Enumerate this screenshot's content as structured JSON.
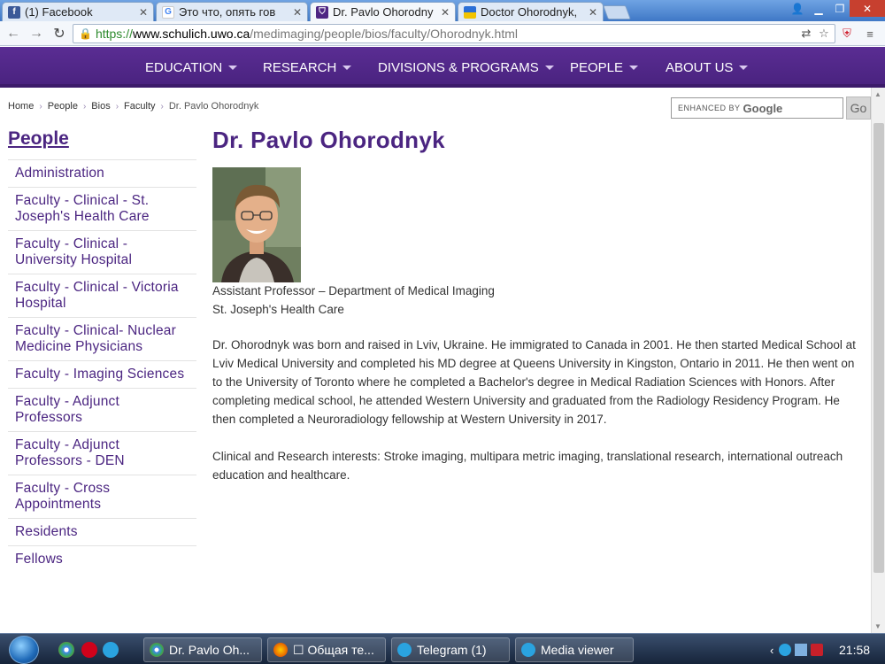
{
  "browser": {
    "tabs": [
      {
        "label": "(1) Facebook",
        "favicon": "facebook-icon",
        "active": false
      },
      {
        "label": "Это что, опять гов",
        "favicon": "google-icon",
        "active": false
      },
      {
        "label": "Dr. Pavlo Ohorodny",
        "favicon": "western-crest-icon",
        "active": true
      },
      {
        "label": "Doctor Ohorodnyk,",
        "favicon": "flag-icon",
        "active": false
      }
    ],
    "url": {
      "scheme": "https://",
      "host": "www.schulich.uwo.ca",
      "path": "/medimaging/people/bios/faculty/Ohorodnyk.html"
    }
  },
  "site_nav": {
    "items": [
      "EDUCATION",
      "RESEARCH",
      "DIVISIONS & PROGRAMS",
      "PEOPLE",
      "ABOUT US"
    ]
  },
  "breadcrumb": {
    "items": [
      "Home",
      "People",
      "Bios",
      "Faculty"
    ],
    "current": "Dr. Pavlo Ohorodnyk"
  },
  "search": {
    "enhanced_by": "ENHANCED BY",
    "brand": "Google",
    "go_label": "Go"
  },
  "sidebar": {
    "title": "People",
    "items": [
      "Administration",
      "Faculty - Clinical - St. Joseph's Health Care",
      "Faculty - Clinical - University Hospital",
      "Faculty - Clinical - Victoria Hospital",
      "Faculty - Clinical- Nuclear Medicine Physicians",
      "Faculty - Imaging Sciences",
      "Faculty - Adjunct Professors",
      "Faculty - Adjunct Professors - DEN",
      "Faculty - Cross Appointments",
      "Residents",
      "Fellows"
    ]
  },
  "profile": {
    "name": "Dr. Pavlo Ohorodnyk",
    "title": "Assistant Professor – Department of Medical Imaging",
    "organization": "St. Joseph's Health Care",
    "bio": "Dr. Ohorodnyk was born and raised in Lviv, Ukraine. He immigrated to Canada in 2001. He then started Medical School at Lviv Medical University and completed his MD degree at Queens University in Kingston, Ontario in 2011. He then went on to the University of Toronto where he completed a Bachelor's degree in Medical Radiation Sciences with Honors. After completing medical school, he attended Western University and graduated from the Radiology Residency Program. He then completed a Neuroradiology fellowship at Western University in 2017.",
    "interests": "Clinical and Research interests: Stroke imaging, multipara metric imaging, translational research, international outreach education and healthcare."
  },
  "taskbar": {
    "buttons": [
      {
        "label": "Dr. Pavlo Oh..."
      },
      {
        "label": "☐ Общая те..."
      },
      {
        "label": "Telegram (1)"
      },
      {
        "label": "Media viewer"
      }
    ],
    "clock": "21:58"
  },
  "colors": {
    "brand_purple": "#4f2683",
    "link_purple": "#4b2581"
  }
}
